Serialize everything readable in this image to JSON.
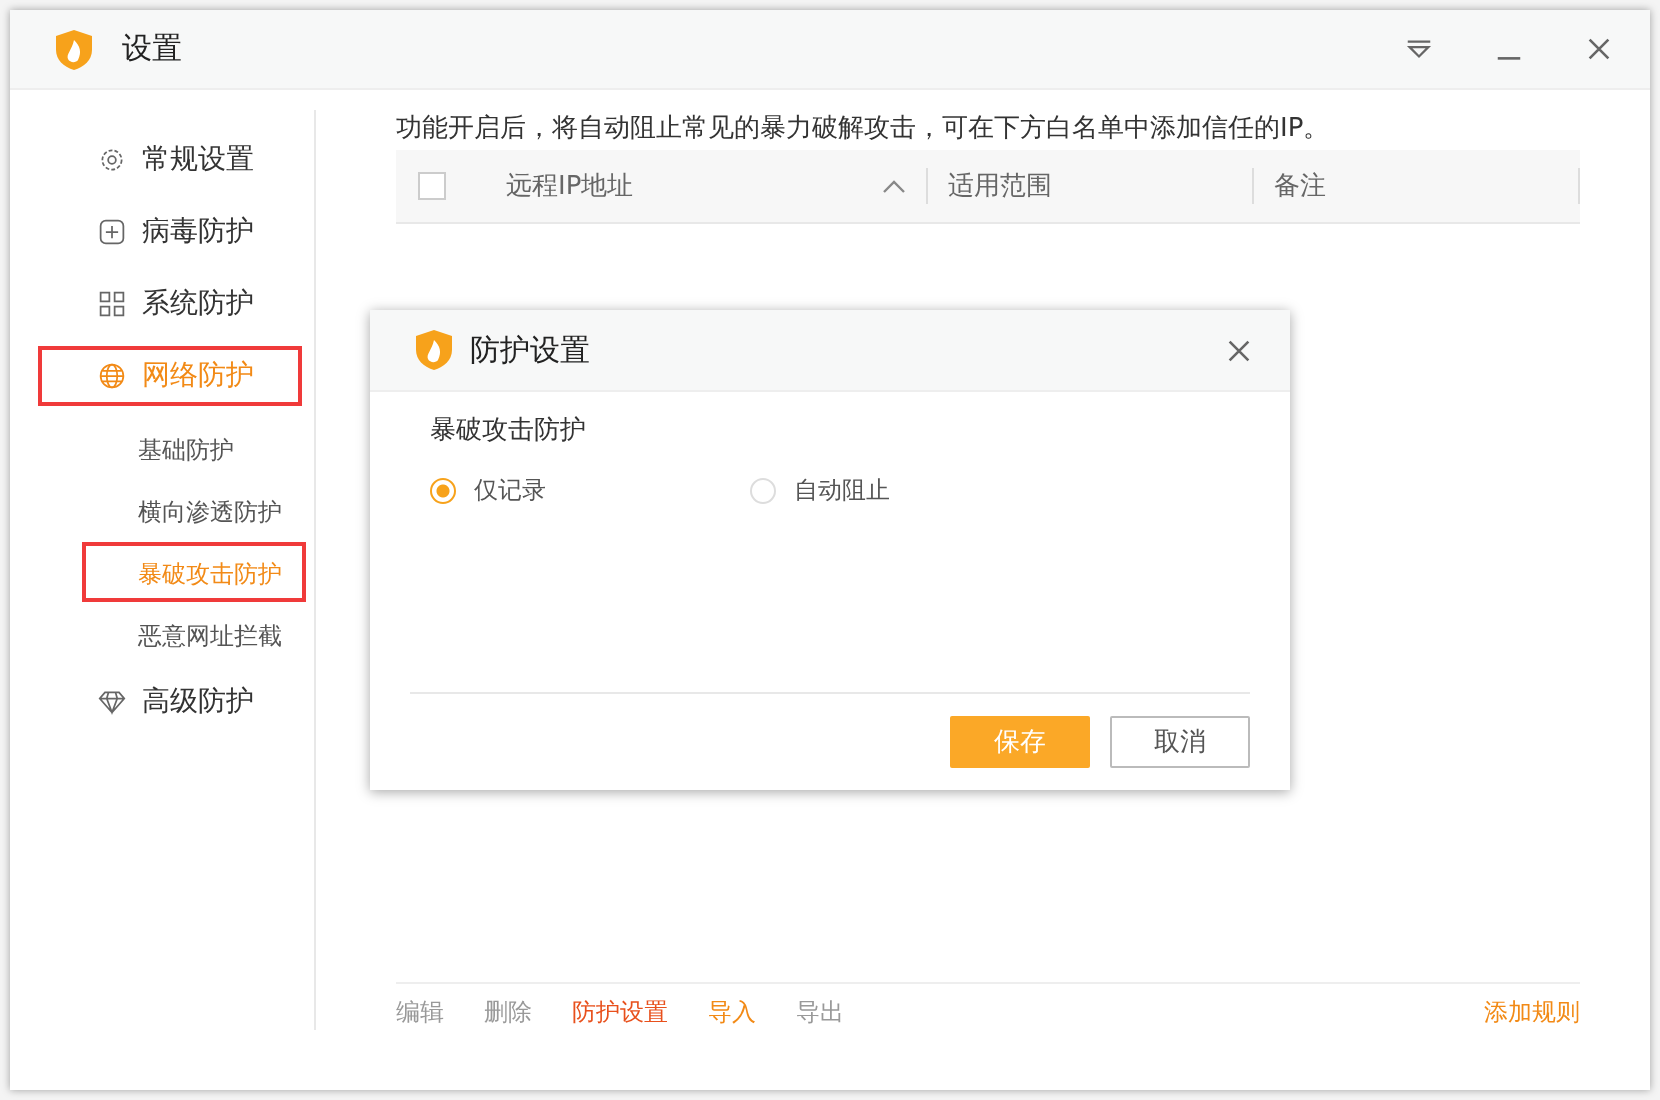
{
  "window": {
    "title": "设置"
  },
  "sidebar": {
    "items": [
      {
        "label": "常规设置",
        "kind": "gear",
        "selected": false,
        "highlighted": false
      },
      {
        "label": "病毒防护",
        "kind": "plus",
        "selected": false,
        "highlighted": false
      },
      {
        "label": "系统防护",
        "kind": "grid",
        "selected": false,
        "highlighted": false
      },
      {
        "label": "网络防护",
        "kind": "globe",
        "selected": true,
        "highlighted": true,
        "children": [
          {
            "label": "基础防护",
            "selected": false,
            "highlighted": false
          },
          {
            "label": "横向渗透防护",
            "selected": false,
            "highlighted": false
          },
          {
            "label": "暴破攻击防护",
            "selected": true,
            "highlighted": true
          },
          {
            "label": "恶意网址拦截",
            "selected": false,
            "highlighted": false
          }
        ]
      },
      {
        "label": "高级防护",
        "kind": "diamond",
        "selected": false,
        "highlighted": false
      }
    ]
  },
  "description": "功能开启后，将自动阻止常见的暴力破解攻击，可在下方白名单中添加信任的IP。",
  "table": {
    "checked": false,
    "columns": [
      {
        "label": "远程IP地址",
        "sorted": true
      },
      {
        "label": "适用范围",
        "sorted": false
      },
      {
        "label": "备注",
        "sorted": false
      }
    ]
  },
  "actions": [
    {
      "label": "编辑",
      "disabled": true,
      "selected": false
    },
    {
      "label": "删除",
      "disabled": true,
      "selected": false
    },
    {
      "label": "防护设置",
      "disabled": false,
      "selected": true
    },
    {
      "label": "导入",
      "disabled": false,
      "selected": false
    },
    {
      "label": "导出",
      "disabled": true,
      "selected": false
    }
  ],
  "add_button": "添加规则",
  "dialog": {
    "title": "防护设置",
    "section": "暴破攻击防护",
    "options": [
      {
        "label": "仅记录",
        "selected": true
      },
      {
        "label": "自动阻止",
        "selected": false
      }
    ],
    "save": "保存",
    "cancel": "取消"
  }
}
